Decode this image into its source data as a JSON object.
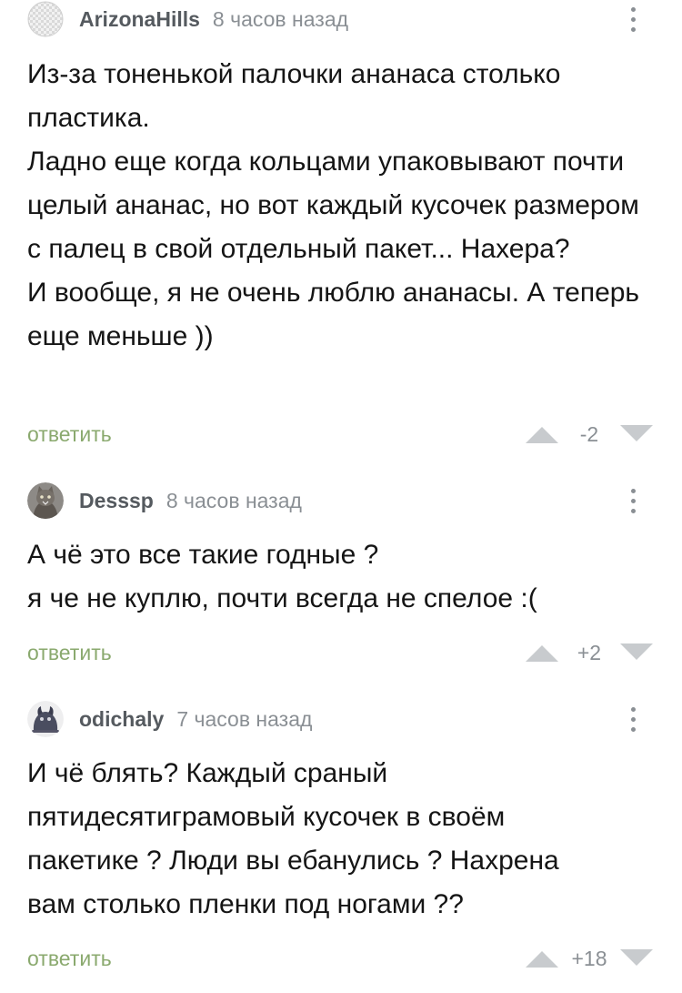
{
  "labels": {
    "reply": "ответить"
  },
  "colors": {
    "reply_link": "#8aa96e",
    "muted_text": "#8a8f94",
    "username": "#555a5f",
    "vote_arrow": "#c8cbce"
  },
  "comments": [
    {
      "author": "ArizonaHills",
      "time": "8 часов назад",
      "avatar_icon": "default-avatar-icon",
      "body": [
        "Из-за тоненькой палочки ананаса столько пластика.",
        "Ладно еще когда кольцами упаковывают почти целый ананас, но вот каждый кусочек размером с палец в свой отдельный пакет... Нахера?",
        "И вообще, я не очень люблю ананасы. А теперь еще меньше ))"
      ],
      "rating": "-2"
    },
    {
      "author": "Desssp",
      "time": "8 часов назад",
      "avatar_icon": "cat-avatar-icon",
      "body": [
        "А чё это все такие годные ?",
        "я че не куплю, почти всегда не спелое :("
      ],
      "rating": "+2"
    },
    {
      "author": "odichaly",
      "time": "7 часов назад",
      "avatar_icon": "creature-avatar-icon",
      "body": [
        "И чё блять? Каждый сраный пятидесятиграмовый кусочек в своём пакетике ? Люди вы ебанулись ? Нахрена вам столько пленки под ногами ??"
      ],
      "rating": "+18"
    }
  ]
}
